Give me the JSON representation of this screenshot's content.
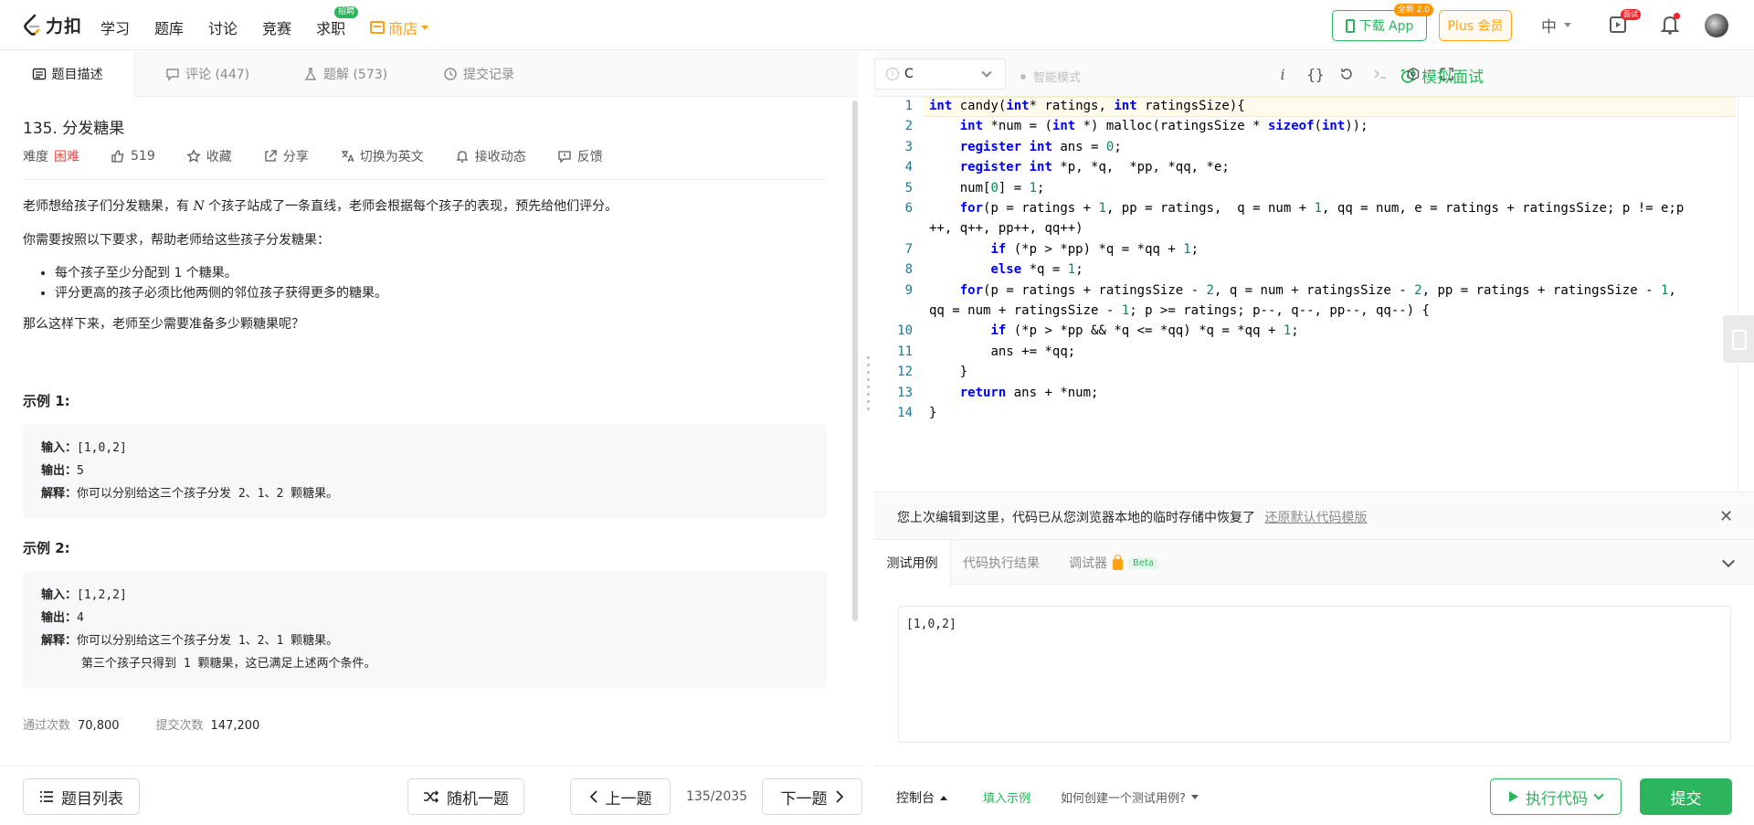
{
  "header": {
    "logo_text": "力扣",
    "nav": [
      {
        "label": "学习"
      },
      {
        "label": "题库"
      },
      {
        "label": "讨论"
      },
      {
        "label": "竞赛"
      },
      {
        "label": "求职",
        "badge": "招聘"
      },
      {
        "label": "商店"
      }
    ],
    "download_app": "下载 App",
    "download_badge": "全新 2.0",
    "plus": "Plus 会员",
    "lang": "中",
    "interview_badge": "面试"
  },
  "left_tabs": [
    {
      "label": "题目描述"
    },
    {
      "label": "评论 (447)"
    },
    {
      "label": "题解 (573)"
    },
    {
      "label": "提交记录"
    }
  ],
  "problem": {
    "title": "135. 分发糖果",
    "difficulty_label": "难度",
    "difficulty": "困难",
    "likes": "519",
    "favorite": "收藏",
    "share": "分享",
    "switch_lang": "切换为英文",
    "follow": "接收动态",
    "feedback": "反馈",
    "desc_pre": "老师想给孩子们分发糖果，有 ",
    "desc_var": "N",
    "desc_post": " 个孩子站成了一条直线，老师会根据每个孩子的表现，预先给他们评分。",
    "req_intro": "你需要按照以下要求，帮助老师给这些孩子分发糖果：",
    "reqs": [
      "每个孩子至少分配到 1 个糖果。",
      "评分更高的孩子必须比他两侧的邻位孩子获得更多的糖果。"
    ],
    "question": "那么这样下来，老师至少需要准备多少颗糖果呢？",
    "example1_title": "示例 1:",
    "example1": {
      "in_label": "输入：",
      "in": "[1,0,2]",
      "out_label": "输出：",
      "out": "5",
      "exp_label": "解释：",
      "exp": "你可以分别给这三个孩子分发 2、1、2 颗糖果。"
    },
    "example2_title": "示例 2:",
    "example2": {
      "in_label": "输入：",
      "in": "[1,2,2]",
      "out_label": "输出：",
      "out": "4",
      "exp_label": "解释：",
      "exp": "你可以分别给这三个孩子分发 1、2、1 颗糖果。",
      "exp2": "第三个孩子只得到 1 颗糖果，这已满足上述两个条件。"
    },
    "passed_label": "通过次数",
    "passed": "70,800",
    "submitted_label": "提交次数",
    "submitted": "147,200"
  },
  "left_bottom": {
    "list": "题目列表",
    "random": "随机一题",
    "prev": "上一题",
    "page": "135/2035",
    "next": "下一题"
  },
  "editor_toolbar": {
    "language": "C",
    "smart_mode": "智能模式",
    "mock_interview": "模拟面试"
  },
  "code": [
    "int candy(int* ratings, int ratingsSize){",
    "    int *num = (int *) malloc(ratingsSize * sizeof(int));",
    "    register int ans = 0;",
    "    register int *p, *q,  *pp, *qq, *e;",
    "    num[0] = 1;",
    "    for(p = ratings + 1, pp = ratings,  q = num + 1, qq = num, e = ratings + ratingsSize; p != e;p",
    "++, q++, pp++, qq++)",
    "        if (*p > *pp) *q = *qq + 1;",
    "        else *q = 1;",
    "    for(p = ratings + ratingsSize - 2, q = num + ratingsSize - 2, pp = ratings + ratingsSize - 1,",
    "qq = num + ratingsSize - 1; p >= ratings; p--, q--, pp--, qq--) {",
    "        if (*p > *pp && *q <= *qq) *q = *qq + 1;",
    "        ans += *qq;",
    "    }",
    "    return ans + *num;",
    "}"
  ],
  "line_numbers": [
    "1",
    "2",
    "3",
    "4",
    "5",
    "6",
    "",
    "7",
    "8",
    "9",
    "",
    "10",
    "11",
    "12",
    "13",
    "14"
  ],
  "restore": {
    "text": "您上次编辑到这里，代码已从您浏览器本地的临时存储中恢复了",
    "link": "还原默认代码模版"
  },
  "result_tabs": {
    "testcase": "测试用例",
    "result": "代码执行结果",
    "debugger": "调试器",
    "beta": "Beta"
  },
  "testcase_value": "[1,0,2]",
  "right_bottom": {
    "console": "控制台",
    "fill_example": "填入示例",
    "how_to": "如何创建一个测试用例?",
    "run": "执行代码",
    "submit": "提交"
  }
}
